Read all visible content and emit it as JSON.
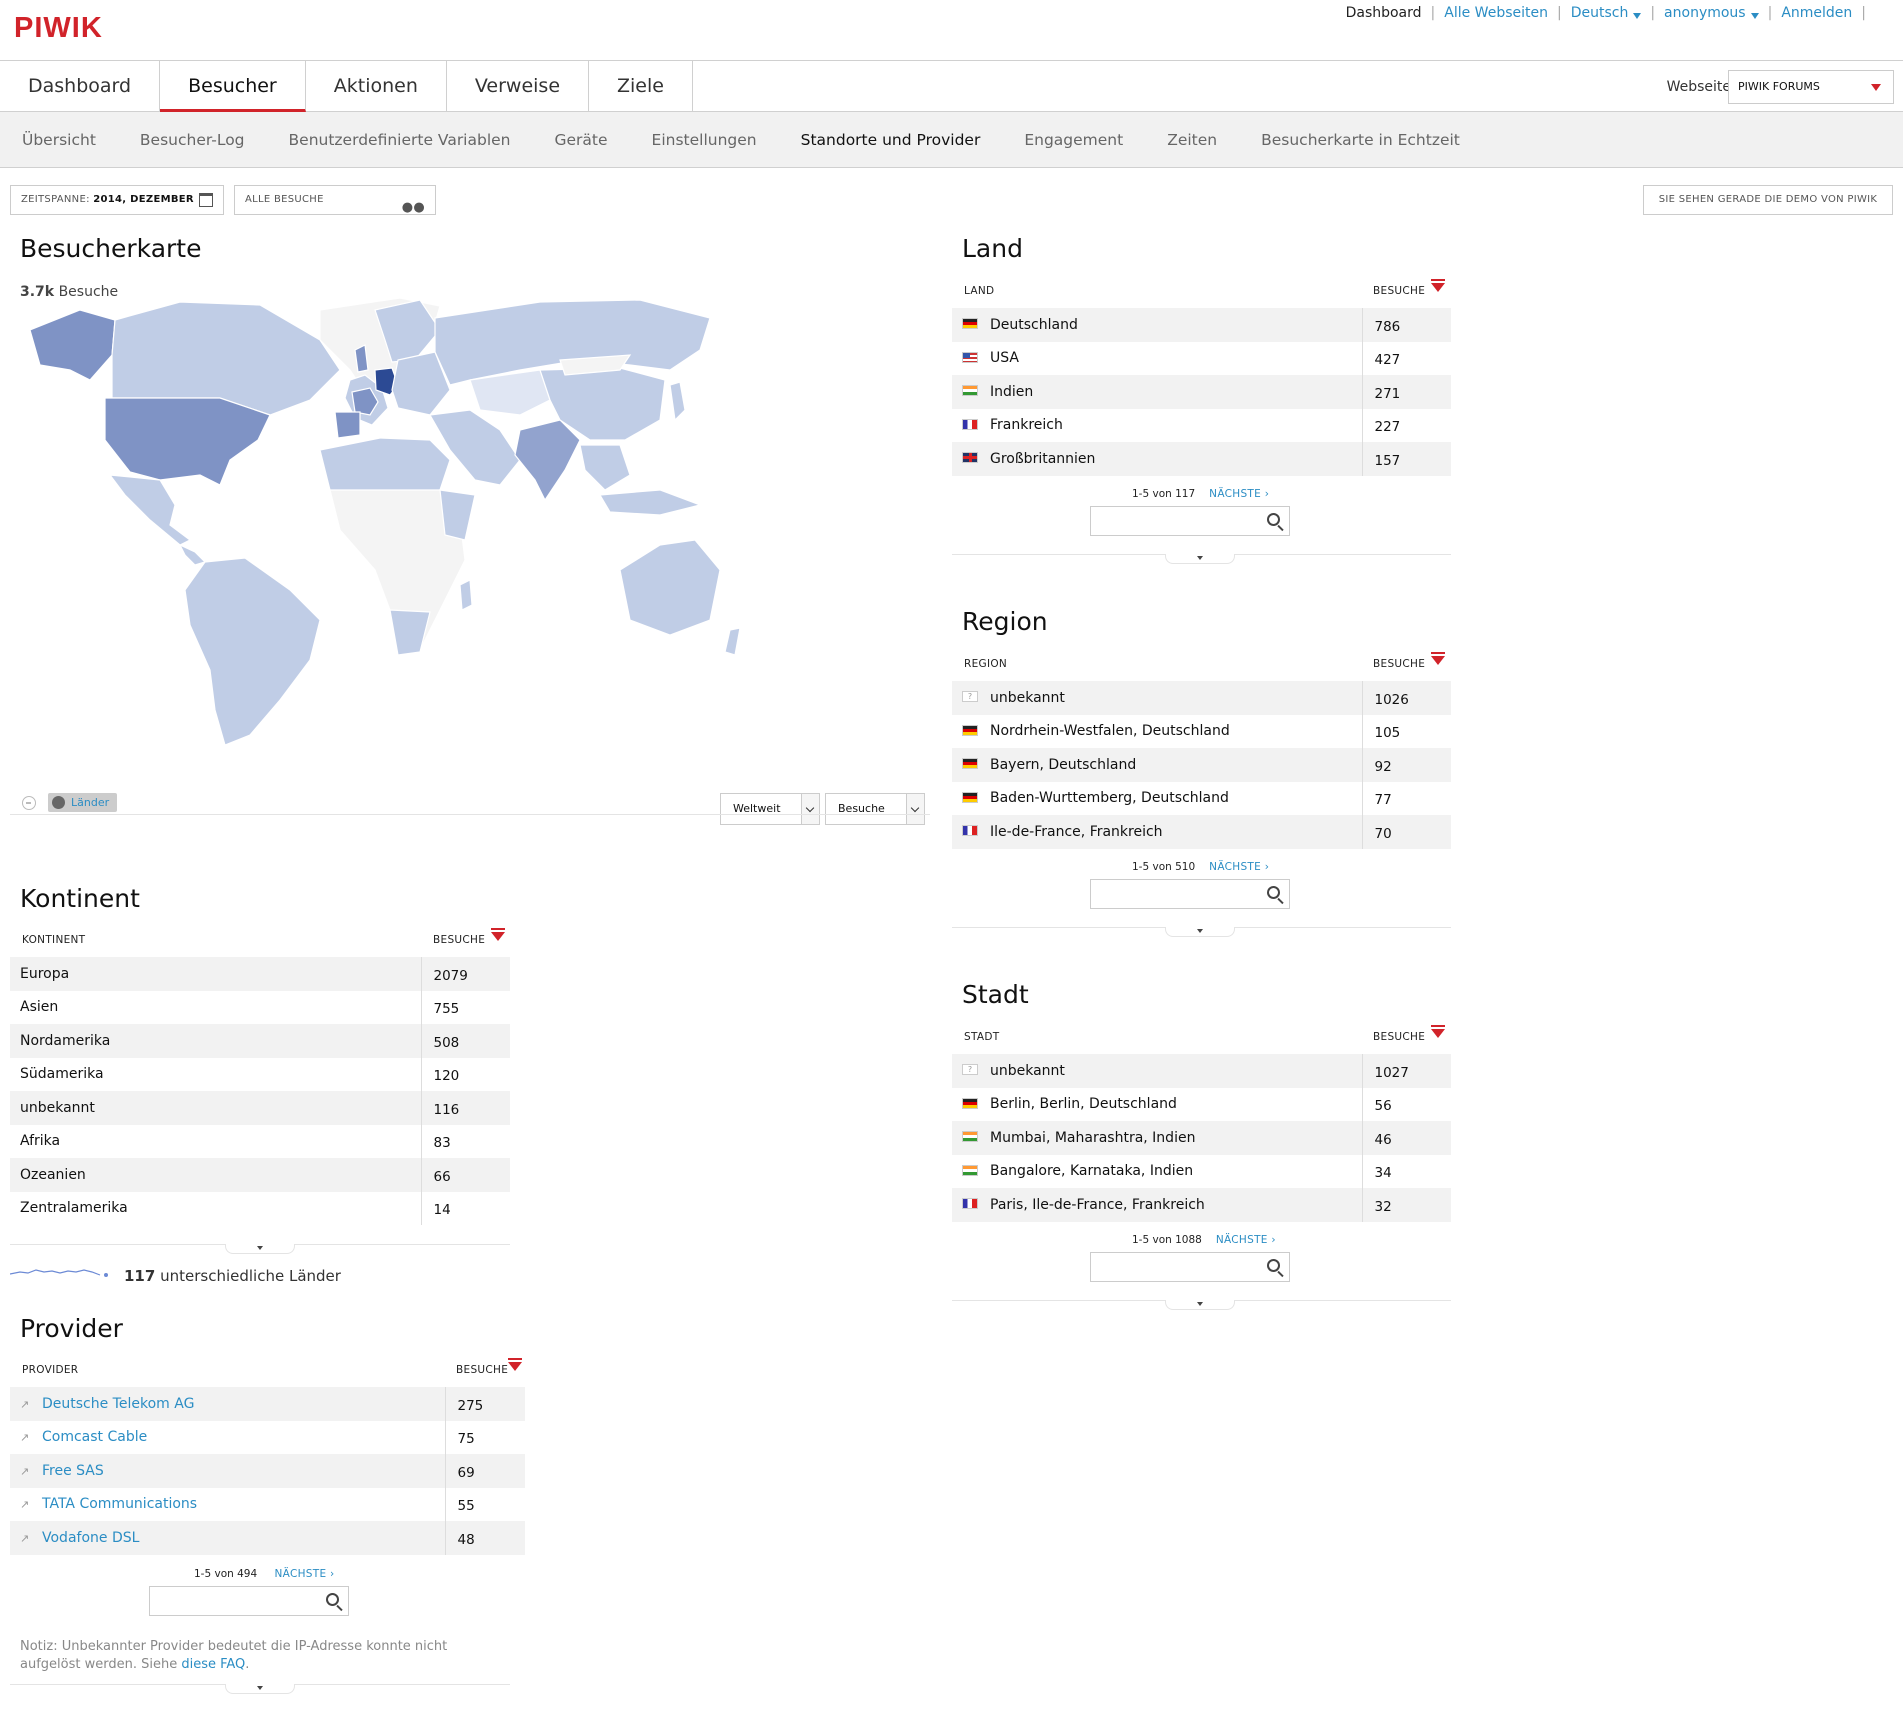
{
  "app": {
    "logo": "PIWIK"
  },
  "topnav": {
    "dashboard": "Dashboard",
    "all_sites": "Alle Webseiten",
    "language": "Deutsch",
    "user": "anonymous",
    "login": "Anmelden"
  },
  "mainmenu": {
    "tabs": [
      "Dashboard",
      "Besucher",
      "Aktionen",
      "Verweise",
      "Ziele"
    ],
    "active": "Besucher",
    "site_label": "Webseite",
    "site_value": "PIWIK FORUMS"
  },
  "submenu": {
    "items": [
      "Übersicht",
      "Besucher-Log",
      "Benutzerdefinierte Variablen",
      "Geräte",
      "Einstellungen",
      "Standorte und Provider",
      "Engagement",
      "Zeiten",
      "Besucherkarte in Echtzeit"
    ],
    "active": "Standorte und Provider"
  },
  "filters": {
    "period_label": "ZEITSPANNE:",
    "period_value": "2014, DEZEMBER",
    "segment": "ALLE BESUCHE",
    "demo": "SIE SEHEN GERADE DIE DEMO VON PIWIK"
  },
  "map": {
    "title": "Besucherkarte",
    "visits_value": "3.7k",
    "visits_label": "Besuche",
    "mode_button": "Länder",
    "scope_select": "Weltweit",
    "metric_select": "Besuche",
    "colors": {
      "high": "#2c4a94",
      "mid": "#7f93c5",
      "low": "#c0cde6",
      "none": "#f4f4f4"
    }
  },
  "continent": {
    "title": "Kontinent",
    "col_label": "KONTINENT",
    "col_value": "BESUCHE",
    "rows": [
      {
        "label": "Europa",
        "value": "2079"
      },
      {
        "label": "Asien",
        "value": "755"
      },
      {
        "label": "Nordamerika",
        "value": "508"
      },
      {
        "label": "Südamerika",
        "value": "120"
      },
      {
        "label": "unbekannt",
        "value": "116"
      },
      {
        "label": "Afrika",
        "value": "83"
      },
      {
        "label": "Ozeanien",
        "value": "66"
      },
      {
        "label": "Zentralamerika",
        "value": "14"
      }
    ],
    "sparkline_count": "117",
    "sparkline_label": "unterschiedliche Länder"
  },
  "provider": {
    "title": "Provider",
    "col_label": "PROVIDER",
    "col_value": "BESUCHE",
    "rows": [
      {
        "label": "Deutsche Telekom AG",
        "value": "275"
      },
      {
        "label": "Comcast Cable",
        "value": "75"
      },
      {
        "label": "Free SAS",
        "value": "69"
      },
      {
        "label": "TATA Communications",
        "value": "55"
      },
      {
        "label": "Vodafone DSL",
        "value": "48"
      }
    ],
    "pager": "1-5 von 494",
    "next": "NÄCHSTE ›",
    "note": "Notiz: Unbekannter Provider bedeutet die IP-Adresse konnte nicht aufgelöst werden. Siehe",
    "note_link": "diese FAQ",
    "note_end": "."
  },
  "country": {
    "title": "Land",
    "col_label": "LAND",
    "col_value": "BESUCHE",
    "rows": [
      {
        "flag": "de",
        "label": "Deutschland",
        "value": "786"
      },
      {
        "flag": "us",
        "label": "USA",
        "value": "427"
      },
      {
        "flag": "in",
        "label": "Indien",
        "value": "271"
      },
      {
        "flag": "fr",
        "label": "Frankreich",
        "value": "227"
      },
      {
        "flag": "gb",
        "label": "Großbritannien",
        "value": "157"
      }
    ],
    "pager": "1-5 von 117",
    "next": "NÄCHSTE ›"
  },
  "region": {
    "title": "Region",
    "col_label": "REGION",
    "col_value": "BESUCHE",
    "rows": [
      {
        "flag": "unk",
        "label": "unbekannt",
        "value": "1026"
      },
      {
        "flag": "de",
        "label": "Nordrhein-Westfalen, Deutschland",
        "value": "105"
      },
      {
        "flag": "de",
        "label": "Bayern, Deutschland",
        "value": "92"
      },
      {
        "flag": "de",
        "label": "Baden-Wurttemberg, Deutschland",
        "value": "77"
      },
      {
        "flag": "fr",
        "label": "Ile-de-France, Frankreich",
        "value": "70"
      }
    ],
    "pager": "1-5 von 510",
    "next": "NÄCHSTE ›"
  },
  "city": {
    "title": "Stadt",
    "col_label": "STADT",
    "col_value": "BESUCHE",
    "rows": [
      {
        "flag": "unk",
        "label": "unbekannt",
        "value": "1027"
      },
      {
        "flag": "de",
        "label": "Berlin, Berlin, Deutschland",
        "value": "56"
      },
      {
        "flag": "in",
        "label": "Mumbai, Maharashtra, Indien",
        "value": "46"
      },
      {
        "flag": "in",
        "label": "Bangalore, Karnataka, Indien",
        "value": "34"
      },
      {
        "flag": "fr",
        "label": "Paris, Ile-de-France, Frankreich",
        "value": "32"
      }
    ],
    "pager": "1-5 von 1088",
    "next": "NÄCHSTE ›"
  }
}
